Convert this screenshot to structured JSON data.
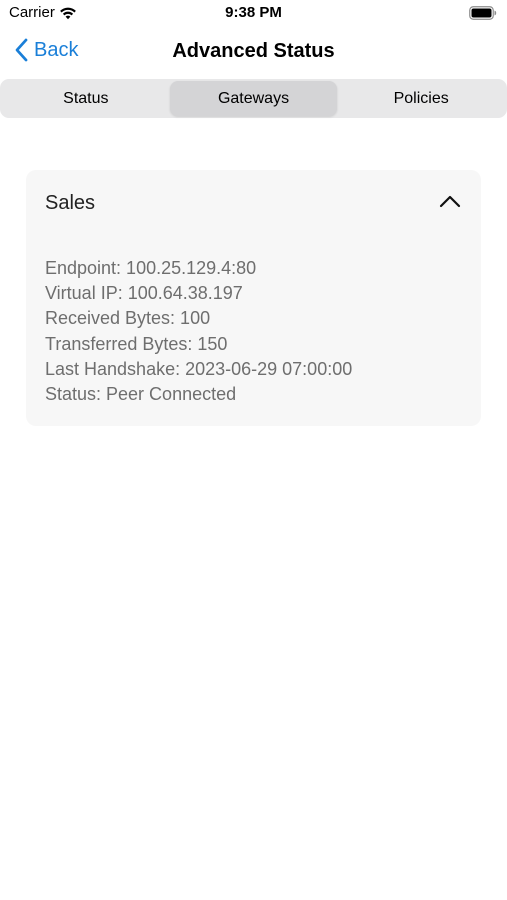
{
  "status_bar": {
    "carrier": "Carrier",
    "time": "9:38 PM"
  },
  "nav": {
    "back_label": "Back",
    "title": "Advanced Status"
  },
  "tabs": [
    {
      "label": "Status",
      "selected": false
    },
    {
      "label": "Gateways",
      "selected": true
    },
    {
      "label": "Policies",
      "selected": false
    }
  ],
  "gateway": {
    "name": "Sales",
    "expanded": true,
    "details": [
      "Endpoint: 100.25.129.4:80",
      "Virtual IP: 100.64.38.197",
      "Received Bytes: 100",
      "Transferred Bytes: 150",
      "Last Handshake: 2023-06-29 07:00:00",
      "Status: Peer Connected"
    ]
  },
  "colors": {
    "accent": "#1a7fd8",
    "segment_bg": "#e8e8e9",
    "segment_selected": "#d4d4d6",
    "card_bg": "#f7f7f7",
    "detail_text": "#6e6e6e"
  },
  "icons": {
    "back": "chevron-left-icon",
    "wifi": "wifi-icon",
    "battery": "battery-icon",
    "collapse": "chevron-up-icon"
  }
}
